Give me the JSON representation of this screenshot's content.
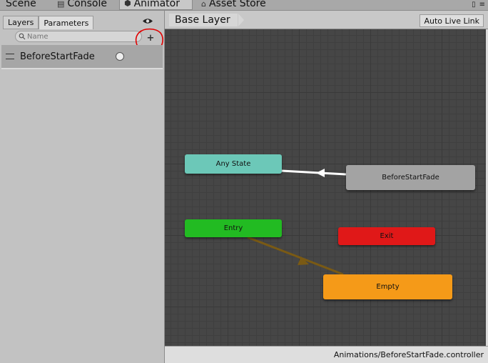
{
  "top_tabs": [
    {
      "label": "Scene",
      "icon": "scene-icon"
    },
    {
      "label": "Console",
      "icon": "console-icon"
    },
    {
      "label": "Animator",
      "icon": "animator-icon"
    },
    {
      "label": "Asset Store",
      "icon": "asset-store-icon"
    }
  ],
  "left_panel": {
    "tabs": [
      "Layers",
      "Parameters"
    ],
    "search_placeholder": "Name",
    "add_button": "+",
    "parameters": [
      {
        "name": "BeforeStartFade",
        "type": "trigger"
      }
    ]
  },
  "graph": {
    "breadcrumb": "Base Layer",
    "auto_live_link": "Auto Live Link",
    "states": {
      "any_state": "Any State",
      "before_start_fade": "BeforeStartFade",
      "entry": "Entry",
      "exit": "Exit",
      "empty": "Empty"
    },
    "colors": {
      "any_state": "#6cc8b8",
      "before_start_fade": "#a3a3a3",
      "entry": "#22bb22",
      "exit": "#e01818",
      "empty": "#f59a18",
      "default_transition": "#7a5a14",
      "transition": "#ffffff"
    },
    "status_path": "Animations/BeforeStartFade.controller"
  },
  "annotation_color": "#e00000"
}
